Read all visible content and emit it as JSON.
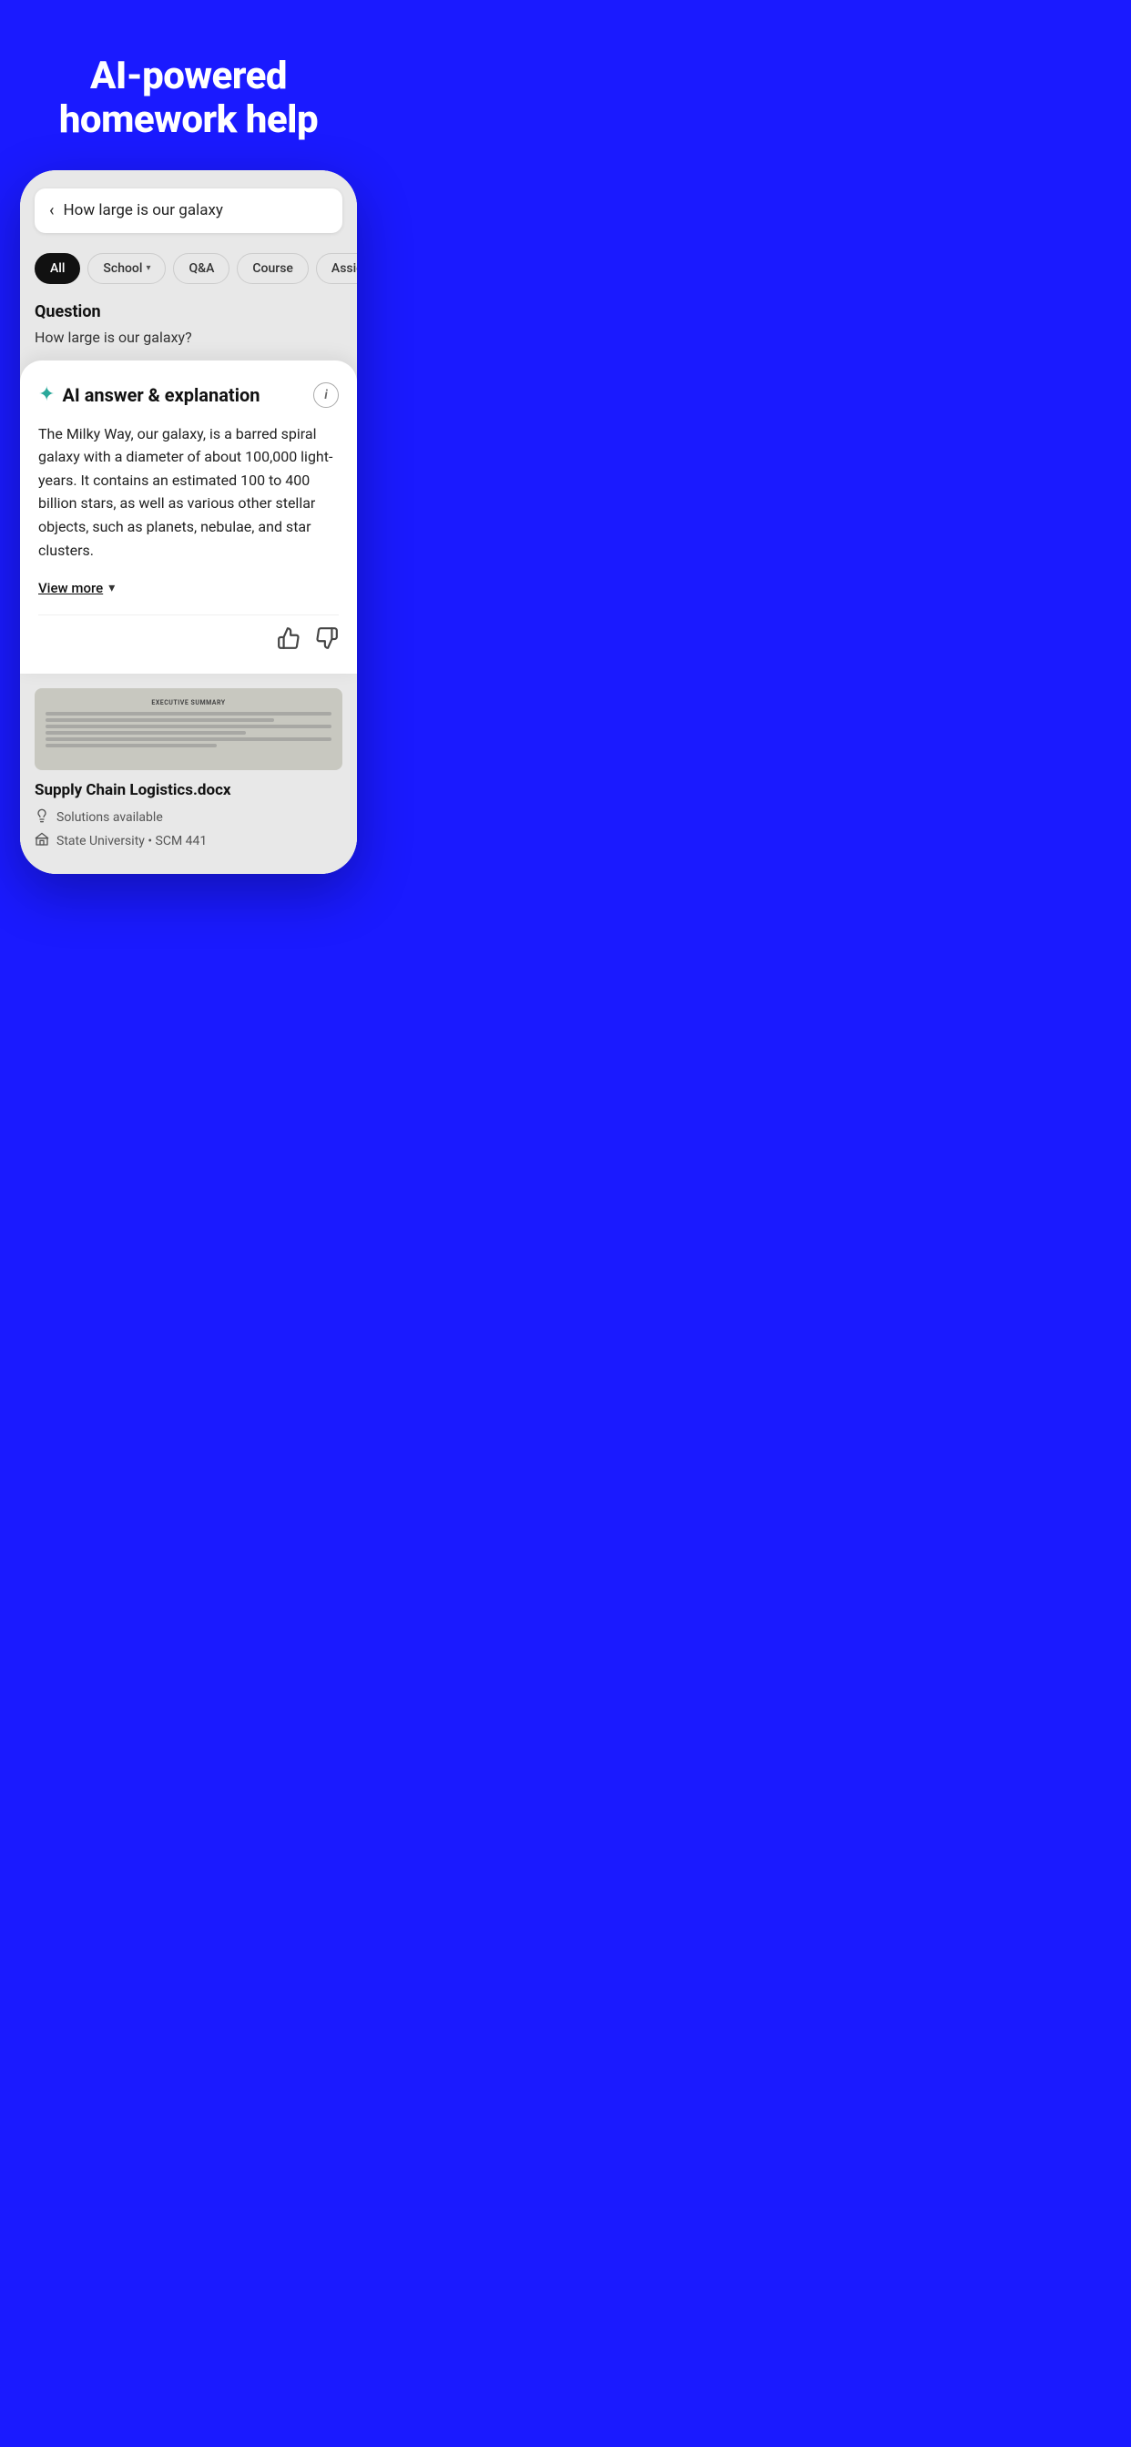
{
  "hero": {
    "title_line1": "AI-powered",
    "title_line2": "homework help",
    "background_color": "#1a1aff"
  },
  "phone": {
    "search": {
      "query": "How large is our galaxy",
      "back_icon": "‹"
    },
    "filters": [
      {
        "label": "All",
        "active": true
      },
      {
        "label": "School",
        "has_chevron": true,
        "active": false
      },
      {
        "label": "Q&A",
        "active": false
      },
      {
        "label": "Course",
        "active": false
      },
      {
        "label": "Assign",
        "active": false
      }
    ],
    "question": {
      "label": "Question",
      "text": "How large is our galaxy?"
    },
    "ai_answer": {
      "title": "AI answer & explanation",
      "sparkle_icon": "✦",
      "info_icon": "i",
      "body": "The Milky Way, our galaxy, is a barred spiral galaxy with a diameter of about 100,000 light-years. It contains an estimated 100 to 400 billion stars, as well as various other stellar objects, such as planets, nebulae, and star clusters.",
      "view_more_label": "View more",
      "thumbs_up_icon": "👍",
      "thumbs_down_icon": "👎"
    },
    "document": {
      "preview_title": "EXECUTIVE SUMMARY",
      "filename": "Supply Chain Logistics.docx",
      "solutions_label": "Solutions available",
      "university_label": "State University • SCM 441",
      "bulb_icon": "💡",
      "building_icon": "🏛"
    }
  }
}
